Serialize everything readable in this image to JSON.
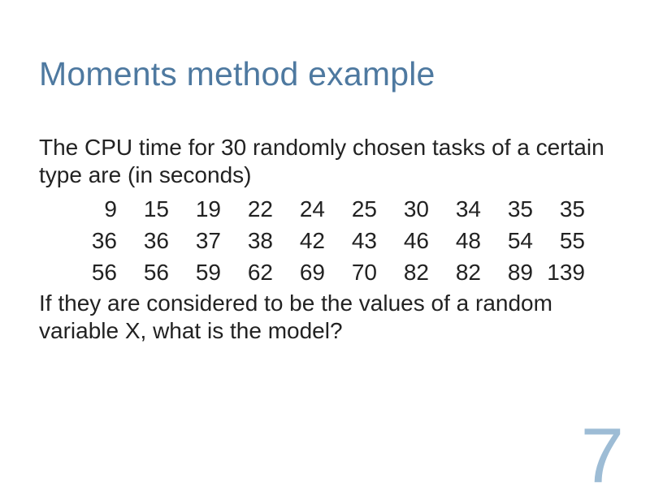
{
  "title": "Moments method example",
  "intro": "The CPU time for 30 randomly chosen tasks of a certain type are (in seconds)",
  "data_rows": [
    [
      "9",
      "15",
      "19",
      "22",
      "24",
      "25",
      "30",
      "34",
      "35",
      "35"
    ],
    [
      "36",
      "36",
      "37",
      "38",
      "42",
      "43",
      "46",
      "48",
      "54",
      "55"
    ],
    [
      "56",
      "56",
      "59",
      "62",
      "69",
      "70",
      "82",
      "82",
      "89",
      "139"
    ]
  ],
  "question": "If they are considered to be the values of a random variable X, what is the model?",
  "page_number": "7"
}
